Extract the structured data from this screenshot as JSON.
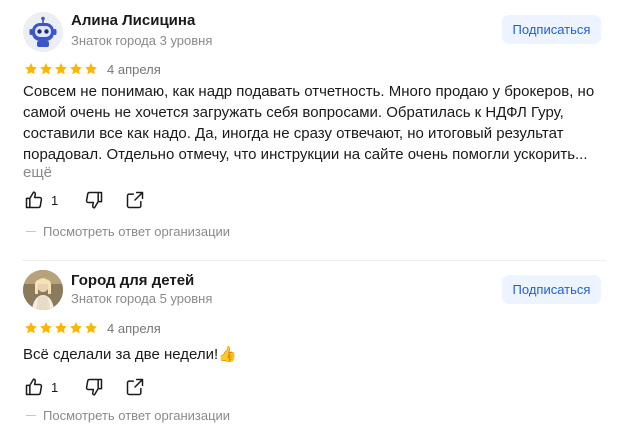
{
  "reviews": [
    {
      "author": "Алина Лисицина",
      "level": "Знаток города 3 уровня",
      "subscribe_label": "Подписаться",
      "rating": 5,
      "date": "4 апреля",
      "text": "Совсем не понимаю, как надр подавать отчетность. Много продаю у брокеров, но самой очень не хочется загружать себя вопросами. Обратилась к НДФЛ Гуру, составили все как надо. Да, иногда не сразу отвечают, но итоговый результат порадовал. Отдельно отмечу, что инструкции на сайте очень помогли ускорить...",
      "more_label": "ещё",
      "likes": "1",
      "org_answer_label": "Посмотреть ответ организации"
    },
    {
      "author": "Город для детей",
      "level": "Знаток города 5 уровня",
      "subscribe_label": "Подписаться",
      "rating": 5,
      "date": "4 апреля",
      "text": "Всё сделали за две недели!👍",
      "likes": "1",
      "org_answer_label": "Посмотреть ответ организации"
    }
  ],
  "colors": {
    "star": "#fcb600",
    "subscribe_bg": "#eef4ff",
    "subscribe_text": "#1d5fd8",
    "muted": "#8a8a8a"
  },
  "icons": [
    "robot-avatar-icon",
    "star-icon",
    "thumb-up-icon",
    "thumb-down-icon",
    "share-icon"
  ]
}
